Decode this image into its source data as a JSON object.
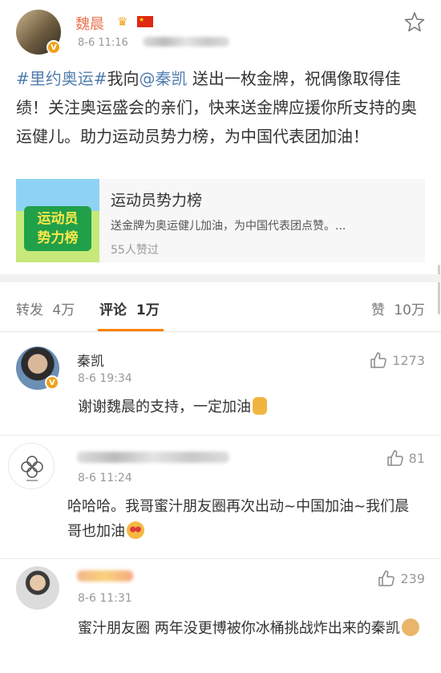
{
  "post": {
    "author": "魏晨",
    "time": "8-6 11:16",
    "text_parts": {
      "hashtag": "#里约奥运#",
      "lead": "我向",
      "mention": "@秦凯",
      "body": " 送出一枚金牌，祝偶像取得佳绩！关注奥运盛会的亲们，快来送金牌应援你所支持的奥运健儿。助力运动员势力榜，为中国代表团加油！"
    },
    "card": {
      "image_text_line1": "运动员",
      "image_text_line2": "势力榜",
      "title": "运动员势力榜",
      "description": "送金牌为奥运健儿加油，为中国代表团点赞。...",
      "likes": "55人赞过"
    }
  },
  "tabs": {
    "repost_label": "转发",
    "repost_count": "4万",
    "comment_label": "评论",
    "comment_count": "1万",
    "like_label": "赞",
    "like_count": "10万"
  },
  "comments": [
    {
      "name": "秦凯",
      "time": "8-6 19:34",
      "text": "谢谢魏晨的支持，一定加油",
      "likes": "1273"
    },
    {
      "name": "",
      "time": "8-6 11:24",
      "text": "哈哈哈。我哥蜜汁朋友圈再次出动~中国加油~我们晨哥也加油",
      "likes": "81"
    },
    {
      "name": "",
      "time": "8-6 11:31",
      "text": "蜜汁朋友圈  两年没更博被你冰桶挑战炸出来的秦凯",
      "likes": "239"
    }
  ],
  "colors": {
    "author": "#eb7350",
    "link": "#507daf",
    "accent": "#ff8200"
  },
  "icons": [
    "star-icon",
    "crown-icon",
    "china-flag-icon",
    "verified-icon",
    "thumbs-up-icon"
  ]
}
